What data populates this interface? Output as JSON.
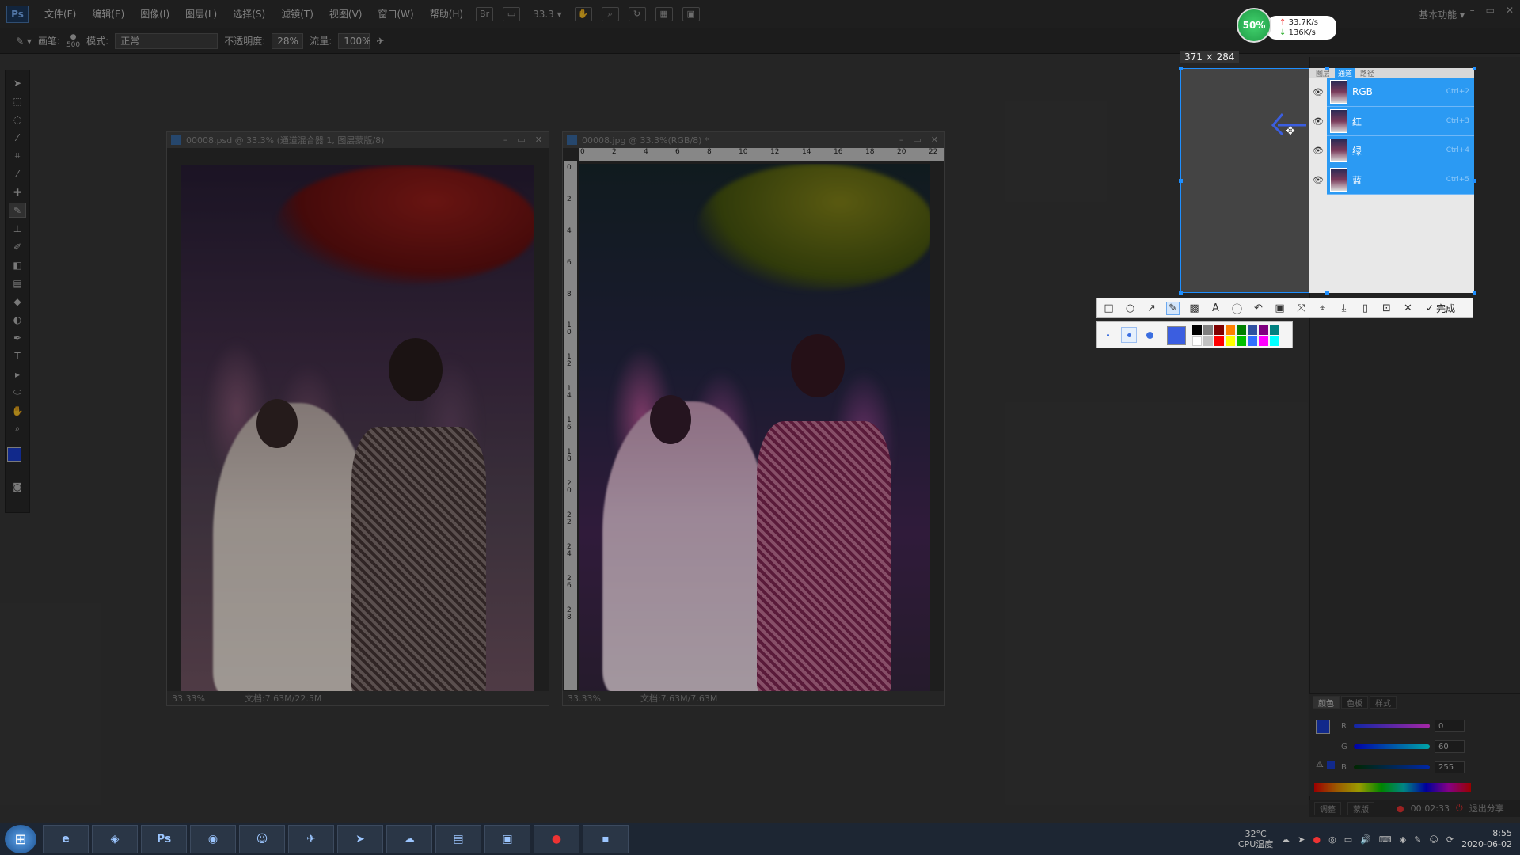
{
  "app": {
    "logo": "Ps"
  },
  "menu": {
    "items": [
      "文件(F)",
      "编辑(E)",
      "图像(I)",
      "图层(L)",
      "选择(S)",
      "滤镜(T)",
      "视图(V)",
      "窗口(W)",
      "帮助(H)"
    ],
    "zoom": "33.3",
    "workspace": "基本功能"
  },
  "options": {
    "brush_label": "画笔:",
    "brush_size": "500",
    "mode_label": "模式:",
    "mode_value": "正常",
    "opacity_label": "不透明度:",
    "opacity_value": "28%",
    "flow_label": "流量:",
    "flow_value": "100%"
  },
  "documents": [
    {
      "title": "00008.psd @ 33.3% (通道混合器 1, 图层蒙版/8)",
      "zoom": "33.33%",
      "doc_info": "文档:7.63M/22.5M"
    },
    {
      "title": "00008.jpg @ 33.3%(RGB/8) *",
      "zoom": "33.33%",
      "doc_info": "文档:7.63M/7.63M",
      "ruler_h": [
        "0",
        "2",
        "4",
        "6",
        "8",
        "10",
        "12",
        "14",
        "16",
        "18",
        "20",
        "22"
      ],
      "ruler_v": [
        "0",
        "2",
        "4",
        "6",
        "8",
        "1 0",
        "1 2",
        "1 4",
        "1 6",
        "1 8",
        "2 0",
        "2 2",
        "2 4",
        "2 6",
        "2 8"
      ]
    }
  ],
  "selection": {
    "size_label": "371 × 284"
  },
  "channels_panel": {
    "tabs": [
      "图层",
      "通道",
      "路径"
    ],
    "active_tab": 1,
    "channels": [
      {
        "name": "RGB",
        "shortcut": "Ctrl+2"
      },
      {
        "name": "红",
        "shortcut": "Ctrl+3"
      },
      {
        "name": "绿",
        "shortcut": "Ctrl+4"
      },
      {
        "name": "蓝",
        "shortcut": "Ctrl+5"
      }
    ]
  },
  "shot_toolbar": {
    "done_label": "完成",
    "active_tool": "pen",
    "current_color": "#3b5ee0",
    "palette": [
      "#000000",
      "#808080",
      "#800000",
      "#ff8000",
      "#008000",
      "#000080",
      "#800080",
      "#008080",
      "#ffffff",
      "#c0c0c0",
      "#ff0000",
      "#ffff00",
      "#00ff00",
      "#0000ff",
      "#ff00ff",
      "#00ffff"
    ]
  },
  "color_panel": {
    "tabs": [
      "颜色",
      "色板",
      "样式"
    ],
    "r": "0",
    "g": "60",
    "b": "255",
    "fg_color": "#1b3fd6"
  },
  "panel_bottom": {
    "tabs": [
      "调整",
      "蒙版"
    ],
    "recording_time": "00:02:33",
    "exit_share": "退出分享"
  },
  "net_widget": {
    "percent": "50%",
    "upload": "33.7K/s",
    "download": "136K/s"
  },
  "tray": {
    "cpu_temp": "32°C",
    "cpu_label": "CPU温度",
    "time": "8:55",
    "date": "2020-06-02"
  },
  "taskbar": {
    "ps_label": "Ps"
  }
}
